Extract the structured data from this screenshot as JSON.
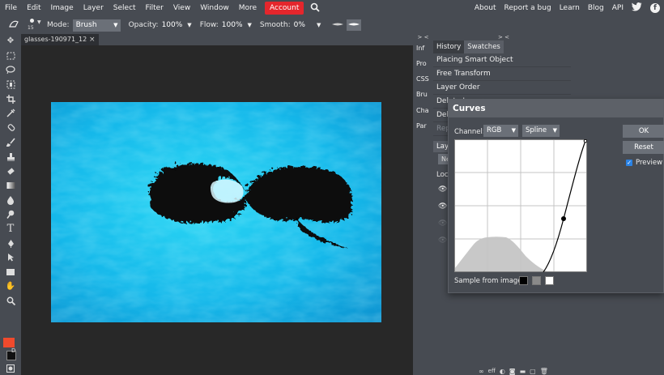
{
  "menu": {
    "items": [
      "File",
      "Edit",
      "Image",
      "Layer",
      "Select",
      "Filter",
      "View",
      "Window",
      "More"
    ],
    "account": "Account",
    "right_links": [
      "About",
      "Report a bug",
      "Learn",
      "Blog",
      "API"
    ]
  },
  "options": {
    "brush_size": "15",
    "mode_label": "Mode:",
    "mode_value": "Brush",
    "opacity_label": "Opacity:",
    "opacity_value": "100%",
    "flow_label": "Flow:",
    "flow_value": "100%",
    "smooth_label": "Smooth:",
    "smooth_value": "0%"
  },
  "document": {
    "tab_title": "glasses-190971_12",
    "close_glyph": "×"
  },
  "collapsed_panels": [
    "Inf",
    "Pro",
    "CSS",
    "Bru",
    "Cha",
    "Par"
  ],
  "panel_arrows": "> <",
  "history": {
    "tabs": [
      "History",
      "Swatches"
    ],
    "items": [
      "Placing Smart Object",
      "Free Transform",
      "Layer Order",
      "Delete Layer",
      "Del",
      "Rep"
    ],
    "layers_tab": "Lay",
    "layers_new": "Ne",
    "lock_label": "Lock"
  },
  "curves": {
    "title": "Curves",
    "channel_label": "Channel:",
    "channel_value": "RGB",
    "mode_value": "Spline",
    "ok_label": "OK",
    "reset_label": "Reset",
    "preview_label": "Preview",
    "sample_label": "Sample from image:"
  },
  "toolbar_icons": [
    "move-icon",
    "marquee-icon",
    "lasso-icon",
    "quick-select-icon",
    "crop-icon",
    "eyedropper-icon",
    "healing-icon",
    "brush-icon",
    "stamp-icon",
    "eraser-icon",
    "gradient-icon",
    "blur-icon",
    "dodge-icon",
    "type-icon",
    "pen-icon",
    "path-select-icon",
    "shape-icon",
    "hand-icon",
    "zoom-icon"
  ],
  "colors": {
    "foreground": "#f04a2d",
    "background": "#111111",
    "accent_account": "#e5262c",
    "checkbox": "#2a82e4"
  }
}
